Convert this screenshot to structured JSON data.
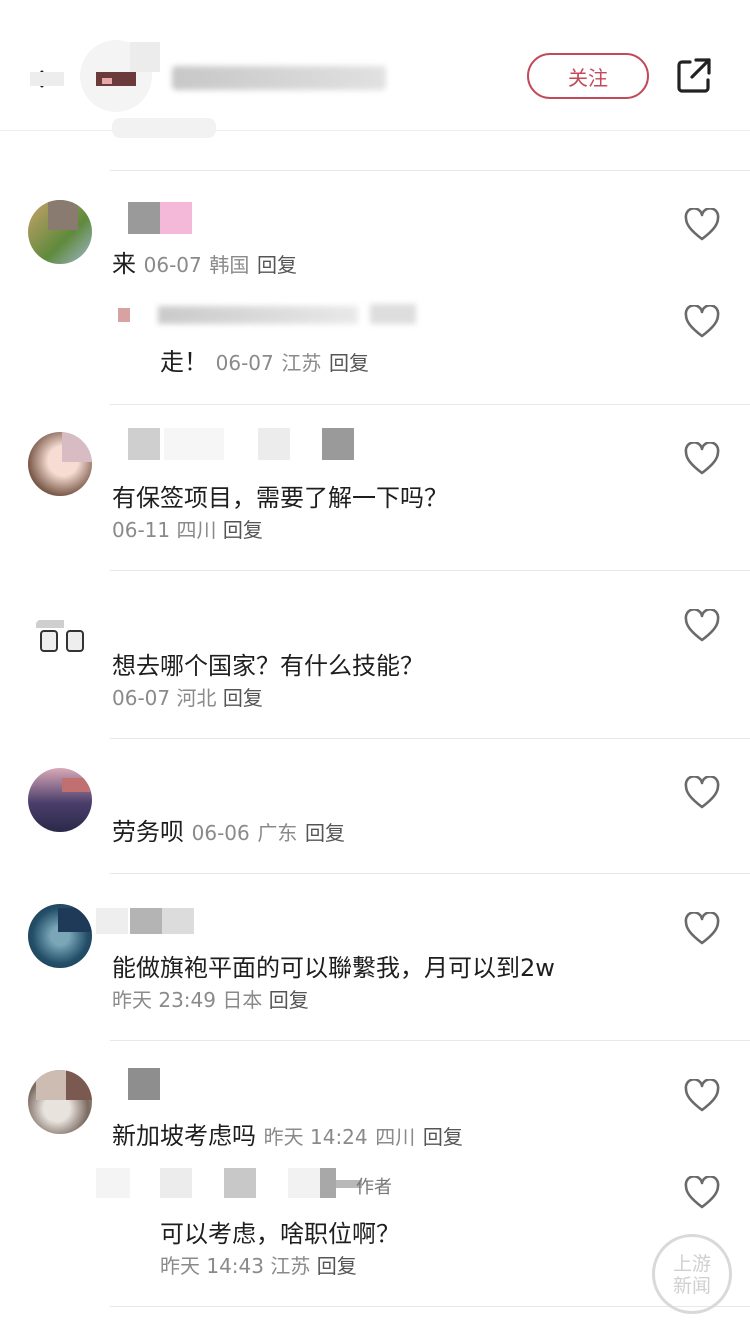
{
  "header": {
    "follow_label": "关注"
  },
  "comments": [
    {
      "text": "来",
      "date": "06-07",
      "location": "韩国",
      "reply_label": "回复"
    },
    {
      "text": "走！",
      "date": "06-07",
      "location": "江苏",
      "reply_label": "回复",
      "is_sub_reply": true
    },
    {
      "text": "有保签项目，需要了解一下吗？",
      "date": "06-11",
      "location": "四川",
      "reply_label": "回复"
    },
    {
      "text": "想去哪个国家？有什么技能？",
      "date": "06-07",
      "location": "河北",
      "reply_label": "回复"
    },
    {
      "text": "劳务呗",
      "date": "06-06",
      "location": "广东",
      "reply_label": "回复"
    },
    {
      "text": "能做旗袍平面的可以聯繫我，月可以到2w",
      "date": "昨天 23:49",
      "location": "日本",
      "reply_label": "回复"
    },
    {
      "text": "新加坡考虑吗",
      "date": "昨天 14:24",
      "location": "四川",
      "reply_label": "回复"
    },
    {
      "text": "可以考虑，啥职位啊？",
      "date": "昨天 14:43",
      "location": "江苏",
      "reply_label": "回复",
      "is_sub_reply": true,
      "author_tag": "作者"
    }
  ],
  "watermark": {
    "line1": "上游",
    "line2": "新闻"
  },
  "colors": {
    "accent": "#c24a5a",
    "meta_text": "#8a8a8a",
    "divider": "#e8e8e8"
  },
  "icons": {
    "back": "chevron-left-icon",
    "share": "share-icon",
    "like": "heart-icon"
  }
}
